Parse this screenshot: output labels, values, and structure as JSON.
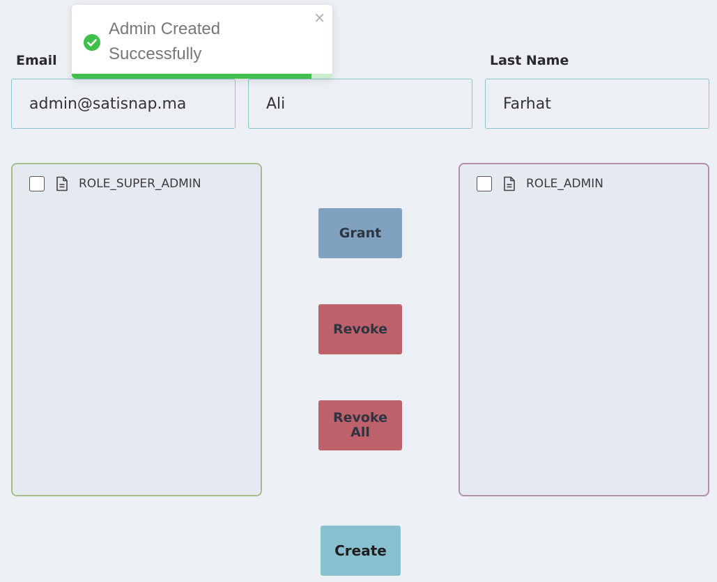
{
  "form": {
    "email": {
      "label": "Email",
      "value": "admin@satisnap.ma"
    },
    "first_name": {
      "value": "Ali"
    },
    "last_name": {
      "label": "Last Name",
      "value": "Farhat"
    }
  },
  "available_roles": {
    "items": [
      {
        "label": "ROLE_SUPER_ADMIN",
        "checked": false,
        "icon": "file-icon"
      }
    ],
    "border_color": "#a3be8c"
  },
  "assigned_roles": {
    "items": [
      {
        "label": "ROLE_ADMIN",
        "checked": false,
        "icon": "file-icon"
      }
    ],
    "border_color": "#b48ead"
  },
  "actions": {
    "grant_label": "Grant",
    "revoke_label": "Revoke",
    "revoke_all_label": "Revoke All",
    "create_label": "Create"
  },
  "toast": {
    "message": "Admin Created Successfully",
    "icon": "check-circle-icon",
    "close_icon": "close-icon",
    "close_symbol": "×",
    "progress_fraction": 0.92,
    "success_color": "#3fc04a"
  },
  "colors": {
    "background": "#eceff4",
    "grant": "#81a1c1",
    "revoke": "#bf616a",
    "create": "#88c0d0",
    "input_border": "#8cc3cc"
  }
}
